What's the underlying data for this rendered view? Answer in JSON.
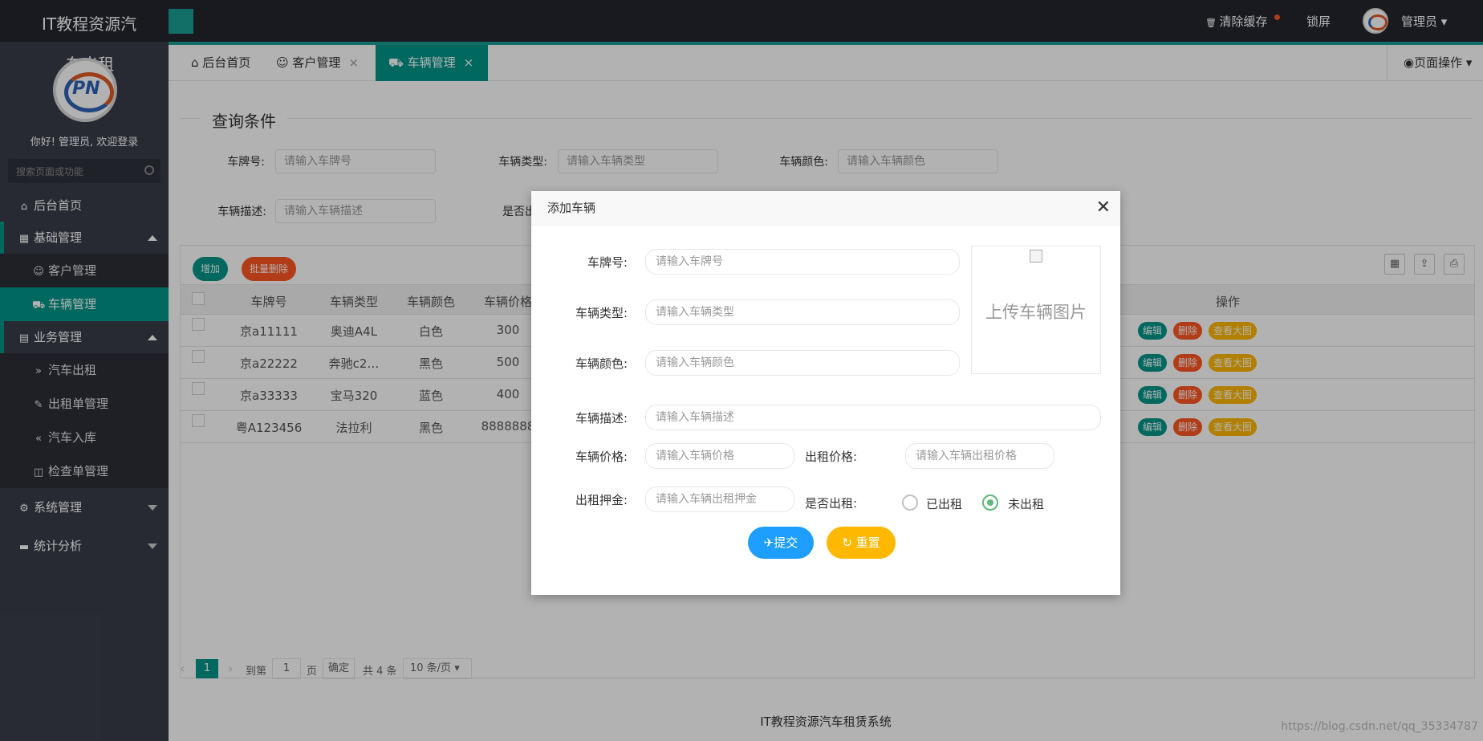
{
  "app": {
    "brand": "IT教程资源汽",
    "sidebar_title": "车出租"
  },
  "topbar": {
    "clear_cache": "清除缓存",
    "lock": "锁屏",
    "user": "管理员"
  },
  "sidebar": {
    "welcome": "你好! 管理员, 欢迎登录",
    "search_placeholder": "搜索页面或功能",
    "home": "后台首页",
    "groups": [
      {
        "label": "基础管理",
        "items": [
          "客户管理",
          "车辆管理"
        ]
      },
      {
        "label": "业务管理",
        "items": [
          "汽车出租",
          "出租单管理",
          "汽车入库",
          "检查单管理"
        ]
      },
      {
        "label": "系统管理"
      },
      {
        "label": "统计分析"
      }
    ]
  },
  "tabs": [
    {
      "label": "后台首页"
    },
    {
      "label": "客户管理"
    },
    {
      "label": "车辆管理"
    }
  ],
  "tab_close": "×",
  "page_ops": "页面操作",
  "query": {
    "legend": "查询条件",
    "fields": [
      {
        "label": "车牌号:",
        "placeholder": "请输入车牌号"
      },
      {
        "label": "车辆类型:",
        "placeholder": "请输入车辆类型"
      },
      {
        "label": "车辆颜色:",
        "placeholder": "请输入车辆颜色"
      },
      {
        "label": "车辆描述:",
        "placeholder": "请输入车辆描述"
      },
      {
        "label": "是否出租"
      }
    ]
  },
  "table": {
    "add": "增加",
    "batch_delete": "批量删除",
    "headers": [
      "车牌号",
      "车辆类型",
      "车辆颜色",
      "车辆价格",
      "操作"
    ],
    "rows": [
      [
        "京a11111",
        "奥迪A4L",
        "白色",
        "300"
      ],
      [
        "京a22222",
        "奔驰c2…",
        "黑色",
        "500"
      ],
      [
        "京a33333",
        "宝马320",
        "蓝色",
        "400"
      ],
      [
        "粤A123456",
        "法拉利",
        "黑色",
        "8888888"
      ]
    ],
    "actions": [
      "编辑",
      "删除",
      "查看大图"
    ]
  },
  "pager": {
    "page": "1",
    "goto": "到第",
    "page_unit": "页",
    "confirm": "确定",
    "total": "共 4 条",
    "size": "10 条/页"
  },
  "footer": "IT教程资源汽车租赁系统",
  "watermark": "https://blog.csdn.net/qq_35334787",
  "dialog": {
    "title": "添加车辆",
    "close": "✕",
    "upload": "上传车辆图片",
    "fields": {
      "plate": {
        "label": "车牌号:",
        "placeholder": "请输入车牌号"
      },
      "type": {
        "label": "车辆类型:",
        "placeholder": "请输入车辆类型"
      },
      "color": {
        "label": "车辆颜色:",
        "placeholder": "请输入车辆颜色"
      },
      "desc": {
        "label": "车辆描述:",
        "placeholder": "请输入车辆描述"
      },
      "price": {
        "label": "车辆价格:",
        "placeholder": "请输入车辆价格"
      },
      "rent_price": {
        "label": "出租价格:",
        "placeholder": "请输入车辆出租价格"
      },
      "deposit": {
        "label": "出租押金:",
        "placeholder": "请输入车辆出租押金"
      },
      "rented": {
        "label": "是否出租:",
        "options": [
          "已出租",
          "未出租"
        ],
        "selected": "未出租"
      }
    },
    "submit": "提交",
    "reset": "重置"
  },
  "colors": {
    "accent": "#009688",
    "orange": "#ff5722",
    "warn": "#ffb800",
    "blue": "#1e9fff"
  }
}
